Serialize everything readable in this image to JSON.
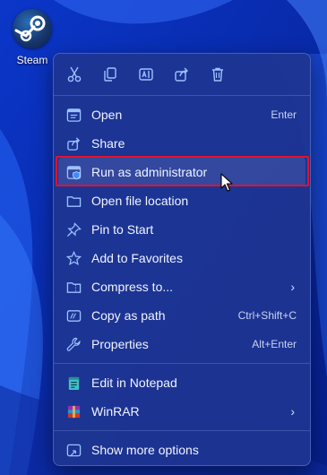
{
  "desktop": {
    "icon_label": "Steam",
    "icon_name": "steam-logo-icon"
  },
  "quick_actions": [
    {
      "name": "cut",
      "icon": "scissors-icon"
    },
    {
      "name": "copy",
      "icon": "copy-icon"
    },
    {
      "name": "rename",
      "icon": "rename-icon"
    },
    {
      "name": "share",
      "icon": "share-icon"
    },
    {
      "name": "delete",
      "icon": "trash-icon"
    }
  ],
  "menu": {
    "group1": [
      {
        "label": "Open",
        "shortcut": "Enter",
        "icon": "open-app-icon"
      },
      {
        "label": "Share",
        "shortcut": "",
        "icon": "share-icon"
      },
      {
        "label": "Run as administrator",
        "shortcut": "",
        "icon": "shield-icon"
      },
      {
        "label": "Open file location",
        "shortcut": "",
        "icon": "folder-icon"
      },
      {
        "label": "Pin to Start",
        "shortcut": "",
        "icon": "pin-icon"
      },
      {
        "label": "Add to Favorites",
        "shortcut": "",
        "icon": "star-icon"
      },
      {
        "label": "Compress to...",
        "shortcut": "",
        "icon": "zip-folder-icon",
        "submenu": true
      },
      {
        "label": "Copy as path",
        "shortcut": "Ctrl+Shift+C",
        "icon": "path-icon"
      },
      {
        "label": "Properties",
        "shortcut": "Alt+Enter",
        "icon": "wrench-icon"
      }
    ],
    "group2": [
      {
        "label": "Edit in Notepad",
        "icon": "notepad-icon"
      },
      {
        "label": "WinRAR",
        "icon": "winrar-icon",
        "submenu": true
      }
    ],
    "group3": [
      {
        "label": "Show more options",
        "icon": "more-options-icon"
      }
    ],
    "submenu_glyph": "›"
  },
  "colors": {
    "highlight_border": "#e3122a",
    "menu_bg": "#1e3591",
    "icon_accent": "#7fb0ff"
  }
}
